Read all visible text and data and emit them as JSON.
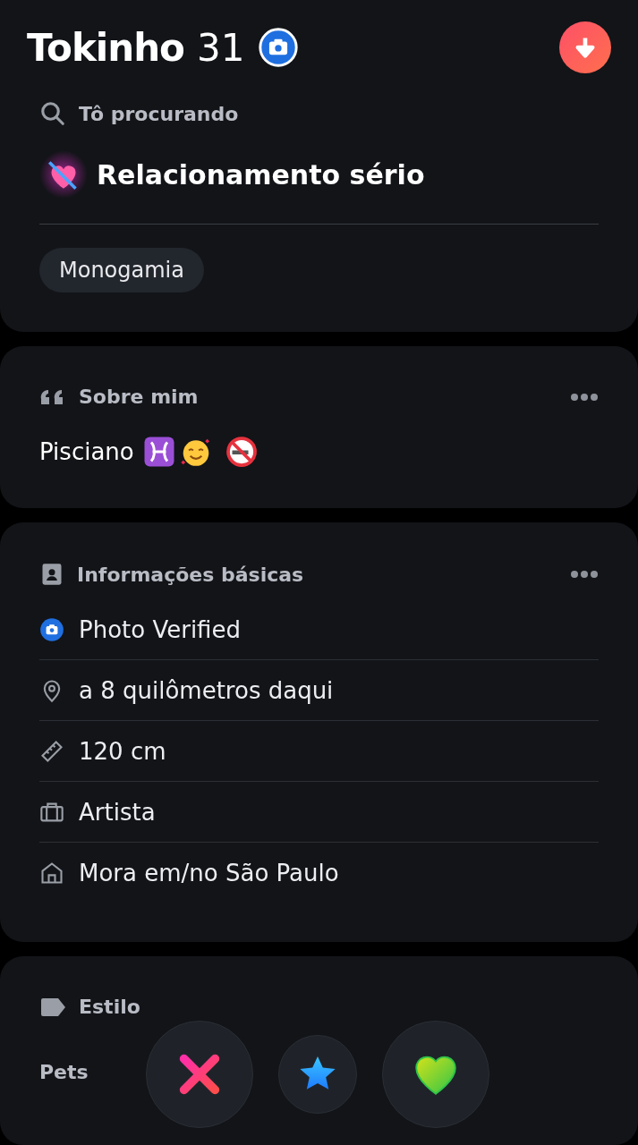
{
  "profile": {
    "name": "Tokinho",
    "age": "31",
    "verified": true
  },
  "looking_for": {
    "label": "Tô procurando",
    "value": "Relacionamento sério",
    "tag": "Monogamia"
  },
  "about": {
    "label": "Sobre mim",
    "text": "Pisciano"
  },
  "basics": {
    "label": "Informações básicas",
    "items": [
      {
        "kind": "verified",
        "text": "Photo Verified"
      },
      {
        "kind": "location",
        "text": "a 8 quilômetros daqui"
      },
      {
        "kind": "height",
        "text": "120 cm"
      },
      {
        "kind": "job",
        "text": "Artista"
      },
      {
        "kind": "home",
        "text": "Mora em/no São Paulo"
      }
    ]
  },
  "lifestyle": {
    "label": "Estilo",
    "first_item": "Pets"
  },
  "actions": [
    {
      "kind": "nope"
    },
    {
      "kind": "super"
    },
    {
      "kind": "like"
    }
  ]
}
